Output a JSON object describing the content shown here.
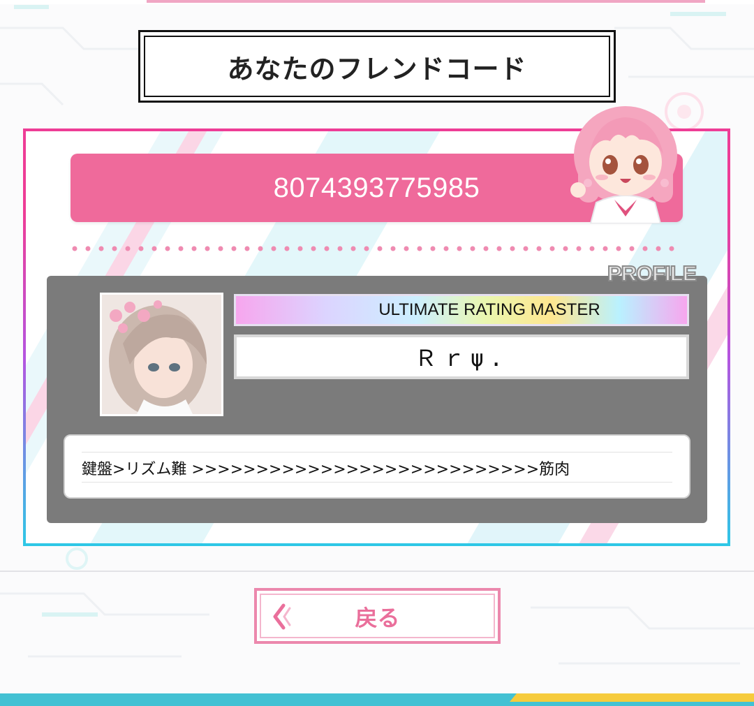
{
  "title": "あなたのフレンドコード",
  "friend_code": "8074393775985",
  "profile_label": "PROFILE",
  "rating_title": "ULTIMATE RATING MASTER",
  "player_name": "Ｒｒψ.",
  "comment": "鍵盤>リズム難 >>>>>>>>>>>>>>>>>>>>>>>>>>>筋肉",
  "back_button": {
    "label": "戻る",
    "icon": "chevron-left-double-icon"
  },
  "colors": {
    "accent_pink": "#ef6a9b",
    "panel_gray": "#7b7b7b",
    "border_cyan": "#2ec7e6",
    "bottom_teal": "#43c1d3",
    "bottom_yellow": "#f6cb3c"
  }
}
